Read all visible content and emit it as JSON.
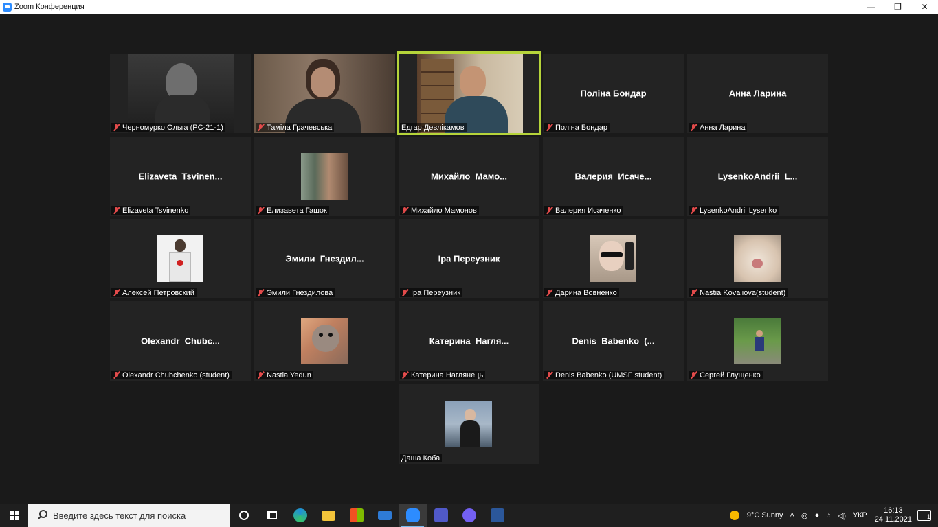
{
  "window": {
    "title": "Zoom Конференция",
    "minimize": "—",
    "restore": "❐",
    "close": "✕"
  },
  "participants": [
    {
      "name": "Черномурко Ольга (PC-21-1)",
      "display": "",
      "mode": "video",
      "muted": true
    },
    {
      "name": "Таміла Грачевська",
      "display": "",
      "mode": "video",
      "muted": true
    },
    {
      "name": "Едгар Девлікамов",
      "display": "",
      "mode": "video",
      "muted": false,
      "speaking": true
    },
    {
      "name": "Поліна Бондар",
      "display": "Поліна Бондар",
      "mode": "name",
      "muted": true
    },
    {
      "name": "Анна Ларина",
      "display": "Анна Ларина",
      "mode": "name",
      "muted": true
    },
    {
      "name": "Elizaveta Tsvinenko",
      "display": "Elizaveta  Tsvinen...",
      "mode": "name",
      "muted": true
    },
    {
      "name": "Елизавета Гашок",
      "display": "",
      "mode": "avatar",
      "muted": true
    },
    {
      "name": "Михайло Мамонов",
      "display": "Михайло  Мамо...",
      "mode": "name",
      "muted": true
    },
    {
      "name": "Валерия Исаченко",
      "display": "Валерия  Исаче...",
      "mode": "name",
      "muted": true
    },
    {
      "name": "LysenkoAndrii Lysenko",
      "display": "LysenkoAndrii  L...",
      "mode": "name",
      "muted": true
    },
    {
      "name": "Алексей Петровский",
      "display": "",
      "mode": "avatar",
      "muted": true
    },
    {
      "name": "Эмили Гнездилова",
      "display": "Эмили  Гнездил...",
      "mode": "name",
      "muted": true
    },
    {
      "name": "Іра Переузник",
      "display": "Іра Переузник",
      "mode": "name",
      "muted": true
    },
    {
      "name": "Дарина Вовненко",
      "display": "",
      "mode": "avatar",
      "muted": true
    },
    {
      "name": "Nastia Kovaliova(student)",
      "display": "",
      "mode": "avatar",
      "muted": true
    },
    {
      "name": "Olexandr Chubchenko (student)",
      "display": "Olexandr  Chubc...",
      "mode": "name",
      "muted": true
    },
    {
      "name": "Nastia Yedun",
      "display": "",
      "mode": "avatar",
      "muted": true
    },
    {
      "name": "Катерина Наглянець",
      "display": "Катерина  Нагля...",
      "mode": "name",
      "muted": true
    },
    {
      "name": "Denis Babenko (UMSF student)",
      "display": "Denis  Babenko  (...",
      "mode": "name",
      "muted": true
    },
    {
      "name": "Сергей Глущенко",
      "display": "",
      "mode": "avatar",
      "muted": true
    },
    {
      "name": "Даша Коба",
      "display": "",
      "mode": "avatar",
      "muted": false
    }
  ],
  "taskbar": {
    "search_placeholder": "Введите здесь текст для поиска",
    "pinned_icons": [
      "cortana-icon",
      "task-view-icon",
      "edge-icon",
      "file-explorer-icon",
      "store-icon",
      "mail-icon",
      "zoom-icon",
      "teams-icon",
      "viber-icon",
      "word-icon"
    ],
    "weather": "9°C  Sunny",
    "language": "УКР",
    "time": "16:13",
    "date": "24.11.2021",
    "notifications": "1"
  },
  "colors": {
    "active_speaker_border": "#b6d43a",
    "tile_bg": "#232323",
    "stage_bg": "#1a1a1a",
    "muted_mic": "#e34b4b"
  }
}
